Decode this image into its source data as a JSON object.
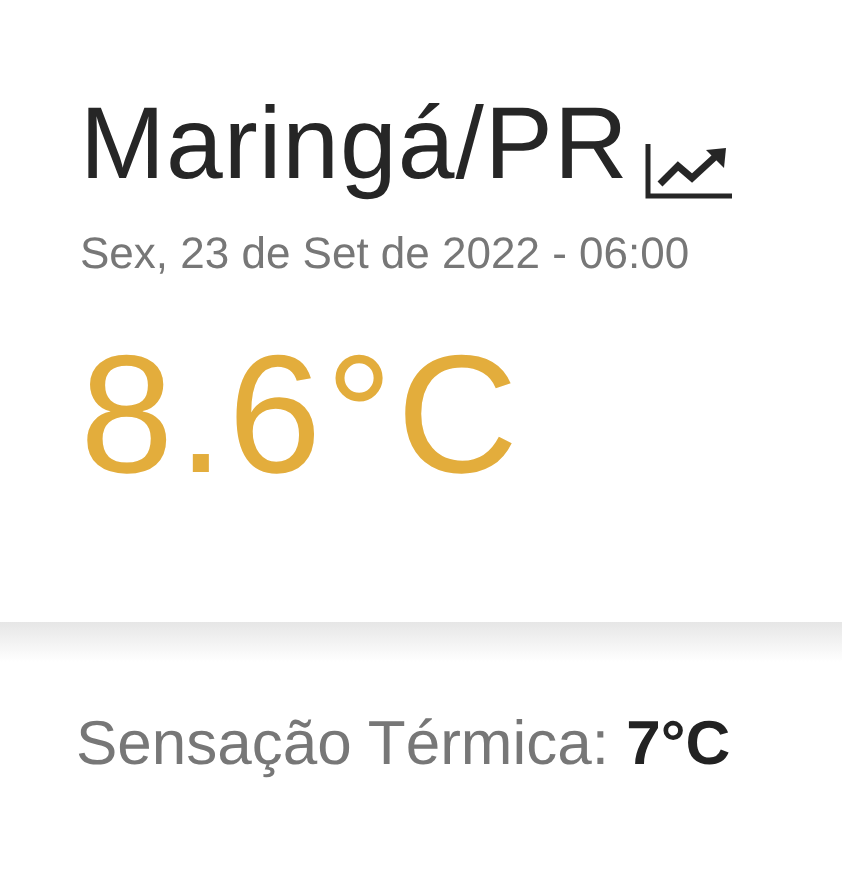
{
  "location": {
    "title": "Maringá/PR"
  },
  "date": "Sex, 23 de Set de 2022 - 06:00",
  "temperature": "8.6°C",
  "feels_like": "Sensação Térmica: **7°C**"
}
